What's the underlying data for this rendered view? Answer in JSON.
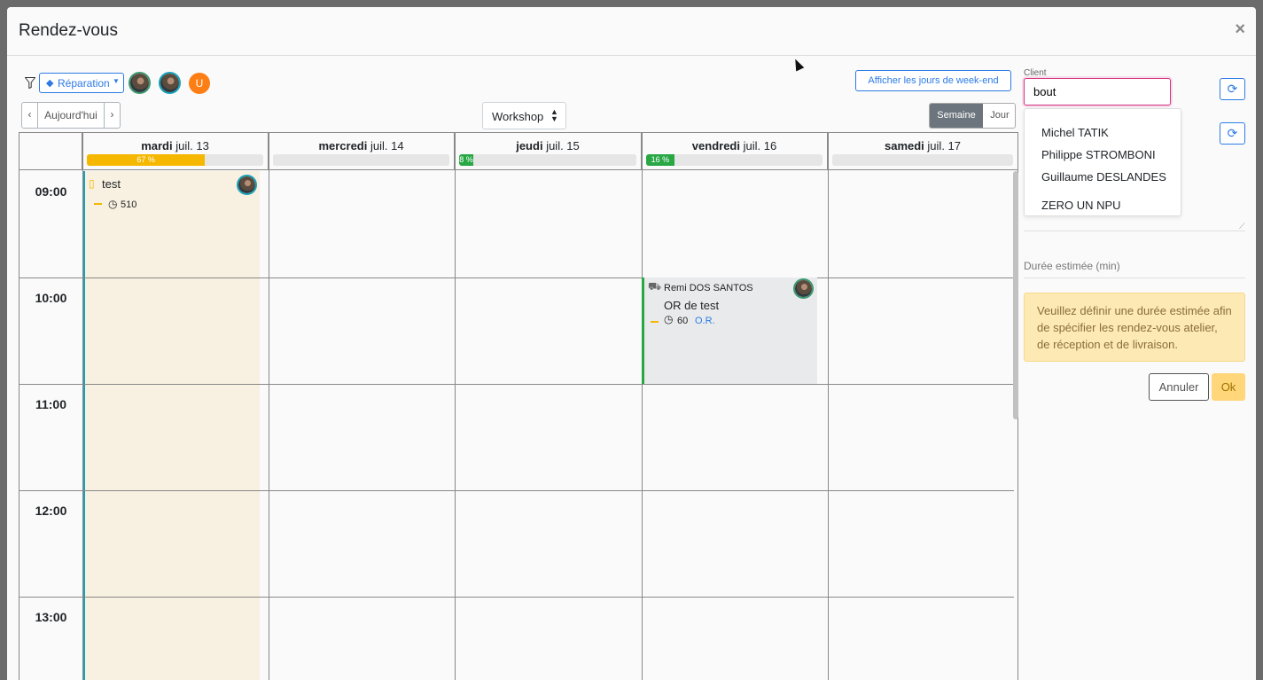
{
  "modal": {
    "title": "Rendez-vous",
    "close": "×"
  },
  "toolbar": {
    "category_label": "Réparation",
    "weekend_button": "Afficher les jours de week-end",
    "today_button": "Aujourd'hui",
    "prev": "‹",
    "next": "›",
    "view_select": "Workshop",
    "view_week": "Semaine",
    "view_day": "Jour",
    "avatar_u": "U"
  },
  "days": [
    {
      "weekday": "mardi",
      "date": "juil. 13",
      "load_pct": 67,
      "load_label": "67 %",
      "load_color": "#f5b700"
    },
    {
      "weekday": "mercredi",
      "date": "juil. 14",
      "load_pct": 0,
      "load_label": "",
      "load_color": "#e6e6e6"
    },
    {
      "weekday": "jeudi",
      "date": "juil. 15",
      "load_pct": 8,
      "load_label": "8 %",
      "load_color": "#28a745"
    },
    {
      "weekday": "vendredi",
      "date": "juil. 16",
      "load_pct": 16,
      "load_label": "16 %",
      "load_color": "#28a745"
    },
    {
      "weekday": "samedi",
      "date": "juil. 17",
      "load_pct": 0,
      "load_label": "",
      "load_color": "#e6e6e6"
    }
  ],
  "hours": [
    "09:00",
    "10:00",
    "11:00",
    "12:00",
    "13:00"
  ],
  "events": [
    {
      "title": "test",
      "duration": "510",
      "accent": "#17a2b8"
    },
    {
      "client": "Remi DOS SANTOS",
      "title": "OR de test",
      "duration": "60",
      "link": "O.R.",
      "accent": "#28a745"
    }
  ],
  "client_panel": {
    "label": "Client",
    "input_value": "bout",
    "suggestions": [
      "Michel TATIK",
      "Philippe STROMBONI",
      "Guillaume DESLANDES",
      "ZERO UN NPU"
    ],
    "duration_label": "Durée estimée (min)",
    "warning": "Veuillez définir une durée estimée afin de spécifier les rendez-vous atelier, de réception et de livraison.",
    "cancel": "Annuler",
    "ok": "Ok"
  }
}
